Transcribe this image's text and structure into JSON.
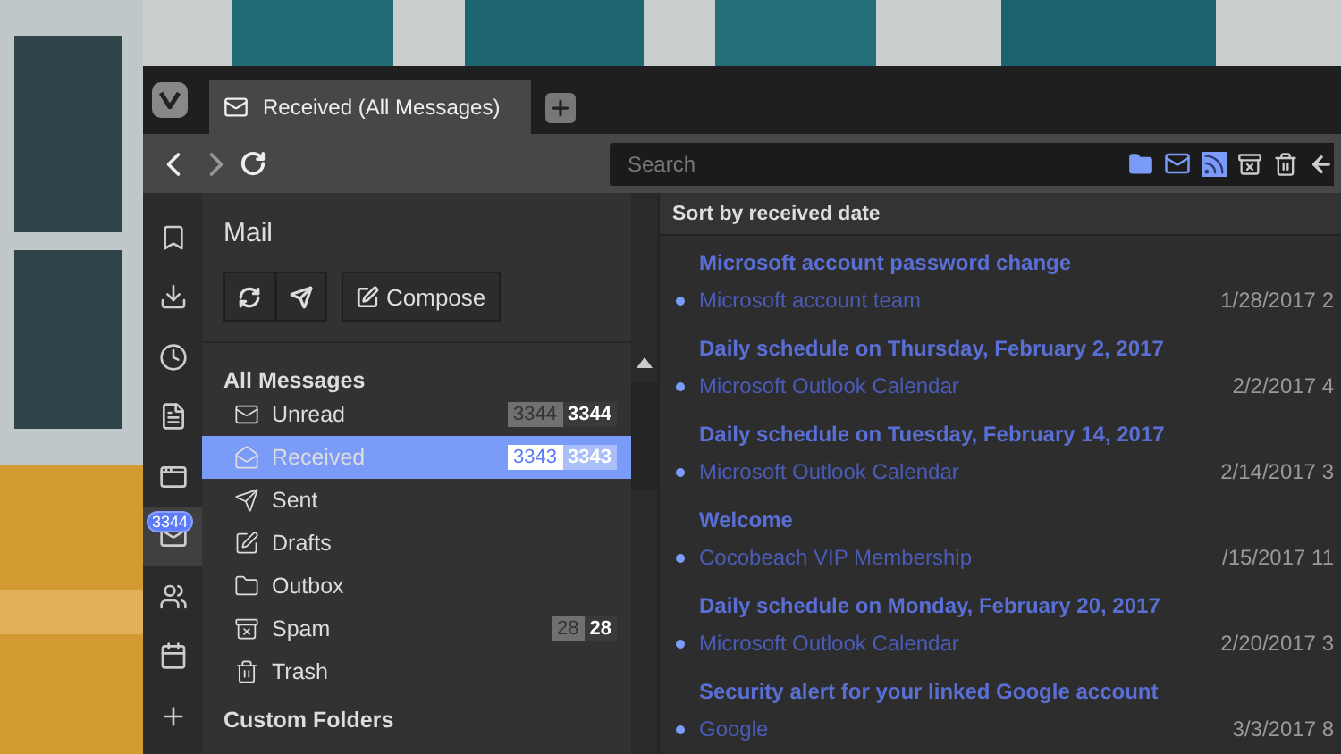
{
  "tab": {
    "title": "Received (All Messages)",
    "selected": true
  },
  "search": {
    "placeholder": "Search"
  },
  "side_panel": {
    "items": [
      {
        "kind": "bookmark",
        "selected": false
      },
      {
        "kind": "download",
        "selected": false
      },
      {
        "kind": "history",
        "selected": false
      },
      {
        "kind": "notes",
        "selected": false
      },
      {
        "kind": "window",
        "selected": false
      },
      {
        "kind": "mail",
        "selected": true,
        "badge": "3344"
      },
      {
        "kind": "contacts",
        "selected": false
      },
      {
        "kind": "calendar",
        "selected": false
      },
      {
        "kind": "add",
        "selected": false
      }
    ]
  },
  "mail": {
    "title": "Mail",
    "compose": "Compose",
    "sections": [
      {
        "title": "All Messages",
        "folders": [
          {
            "kind": "unread",
            "name": "Unread",
            "unread": "3344",
            "total": "3344",
            "selected": false
          },
          {
            "kind": "received",
            "name": "Received",
            "unread": "3343",
            "total": "3343",
            "selected": true
          },
          {
            "kind": "sent",
            "name": "Sent",
            "selected": false
          },
          {
            "kind": "drafts",
            "name": "Drafts",
            "selected": false
          },
          {
            "kind": "outbox",
            "name": "Outbox",
            "selected": false
          },
          {
            "kind": "spam",
            "name": "Spam",
            "unread": "28",
            "total": "28",
            "selected": false
          },
          {
            "kind": "trash",
            "name": "Trash",
            "selected": false
          }
        ]
      },
      {
        "title": "Custom Folders"
      }
    ]
  },
  "list": {
    "sort_label": "Sort by received date",
    "messages": [
      {
        "subject": "Microsoft account password change",
        "sender": "Microsoft account team",
        "date": "1/28/2017 2",
        "unread": true
      },
      {
        "subject": "Daily schedule on Thursday, February 2, 2017",
        "sender": "Microsoft Outlook Calendar",
        "date": "2/2/2017 4",
        "unread": true
      },
      {
        "subject": "Daily schedule on Tuesday, February 14, 2017",
        "sender": "Microsoft Outlook Calendar",
        "date": "2/14/2017 3",
        "unread": true
      },
      {
        "subject": "Welcome",
        "sender": "Cocobeach VIP Membership",
        "date": "/15/2017 11",
        "unread": true
      },
      {
        "subject": "Daily schedule on Monday, February 20, 2017",
        "sender": "Microsoft Outlook Calendar",
        "date": "2/20/2017 3",
        "unread": true
      },
      {
        "subject": "Security alert for your linked Google account",
        "sender": "Google",
        "date": "3/3/2017 8",
        "unread": true
      }
    ]
  }
}
